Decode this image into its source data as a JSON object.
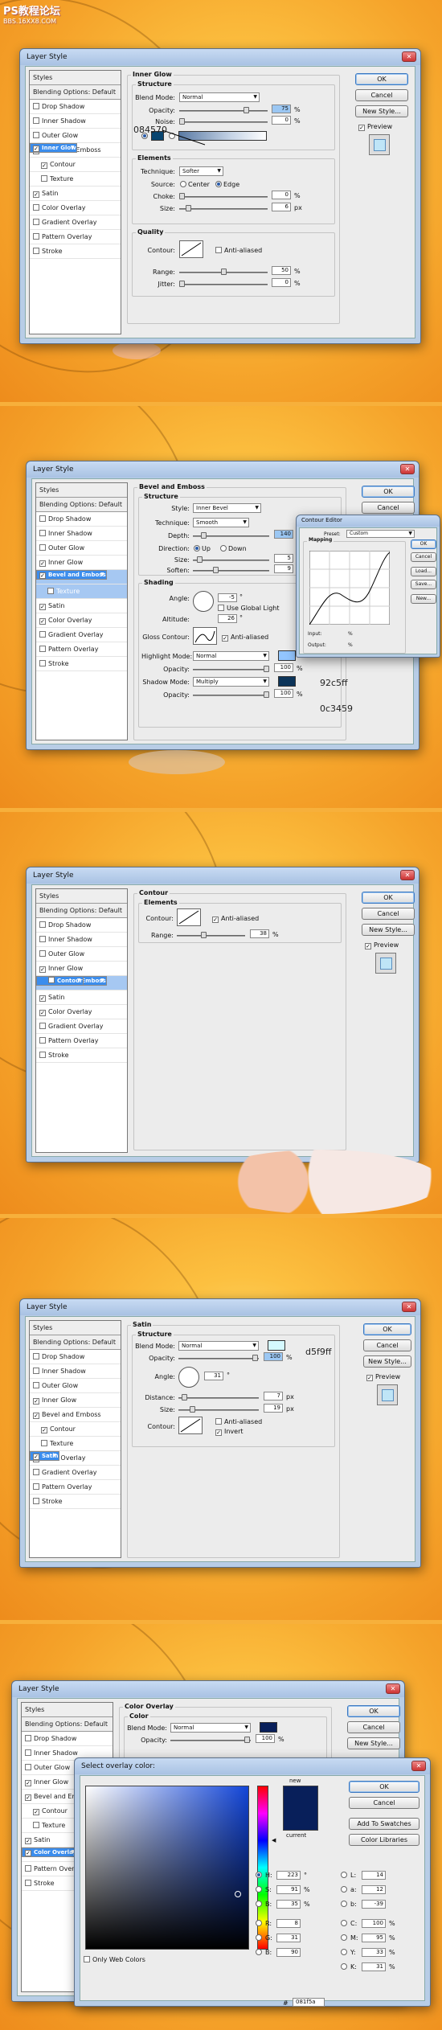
{
  "site_logo": {
    "title": "PS教程论坛",
    "subtitle": "BBS.16XX8.COM"
  },
  "dialog_title": "Layer Style",
  "buttons": {
    "ok": "OK",
    "cancel": "Cancel",
    "new_style": "New Style...",
    "preview": "Preview"
  },
  "style_list": [
    "Styles",
    "Blending Options: Default",
    "Drop Shadow",
    "Inner Shadow",
    "Outer Glow",
    "Inner Glow",
    "Bevel and Emboss",
    "Contour",
    "Texture",
    "Satin",
    "Color Overlay",
    "Gradient Overlay",
    "Pattern Overlay",
    "Stroke"
  ],
  "labels": {
    "structure": "Structure",
    "elements": "Elements",
    "quality": "Quality",
    "shading": "Shading",
    "blend_mode": "Blend Mode:",
    "opacity": "Opacity:",
    "noise": "Noise:",
    "technique": "Technique:",
    "source": "Source:",
    "center": "Center",
    "edge": "Edge",
    "choke": "Choke:",
    "size": "Size:",
    "contour": "Contour:",
    "anti_aliased": "Anti-aliased",
    "range": "Range:",
    "jitter": "Jitter:",
    "style": "Style:",
    "depth": "Depth:",
    "direction": "Direction:",
    "up": "Up",
    "down": "Down",
    "soften": "Soften:",
    "angle": "Angle:",
    "use_global_light": "Use Global Light",
    "altitude": "Altitude:",
    "gloss_contour": "Gloss Contour:",
    "highlight_mode": "Highlight Mode:",
    "shadow_mode": "Shadow Mode:",
    "distance": "Distance:",
    "invert": "Invert",
    "color": "Color",
    "px": "px",
    "pct": "%",
    "deg": "°"
  },
  "s1": {
    "section": "Inner Glow",
    "blend_mode": "Normal",
    "opacity": "75",
    "noise": "0",
    "color_label": "084570",
    "technique": "Softer",
    "choke": "0",
    "size": "6",
    "range": "50",
    "jitter": "0",
    "color": "#084570"
  },
  "s2": {
    "section": "Bevel and Emboss",
    "style": "Inner Bevel",
    "technique": "Smooth",
    "depth": "140",
    "size": "5",
    "soften": "9",
    "angle": "-5",
    "altitude": "26",
    "highlight_mode": "Normal",
    "highlight_opacity": "100",
    "shadow_mode": "Multiply",
    "shadow_opacity": "100",
    "highlight_label": "92c5ff",
    "shadow_label": "0c3459",
    "highlight_color": "#92c5ff",
    "shadow_color": "#0c3459",
    "contour_editor": {
      "title": "Contour Editor",
      "preset_label": "Preset:",
      "preset": "Custom",
      "mapping": "Mapping",
      "input": "Input:",
      "output": "Output:",
      "pct": "%",
      "ok": "OK",
      "cancel": "Cancel",
      "load": "Load...",
      "save": "Save...",
      "new": "New..."
    }
  },
  "s3": {
    "section": "Contour",
    "range": "38"
  },
  "s4": {
    "section": "Satin",
    "blend_mode": "Normal",
    "opacity": "100",
    "angle": "31",
    "distance": "7",
    "size": "19",
    "color_label": "d5f9ff",
    "color": "#d5f9ff"
  },
  "s5": {
    "section": "Color Overlay",
    "blend_mode": "Normal",
    "opacity": "100",
    "color": "#081f5a",
    "picker": {
      "title": "Select overlay color:",
      "new": "new",
      "current": "current",
      "ok": "OK",
      "cancel": "Cancel",
      "add_swatches": "Add To Swatches",
      "color_libraries": "Color Libraries",
      "only_web": "Only Web Colors",
      "H": "223",
      "S": "91",
      "B": "35",
      "R": "8",
      "G": "31",
      "Bv": "90",
      "L": "14",
      "a": "12",
      "b": "-39",
      "C": "100",
      "M": "95",
      "Y": "33",
      "K": "31",
      "hex": "081f5a",
      "hex_label": "#",
      "h_unit": "°",
      "pct": "%"
    }
  }
}
